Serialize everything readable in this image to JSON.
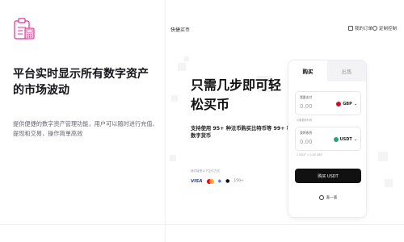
{
  "left": {
    "title": "平台实时显示所有数字资产的市场波动",
    "description": "提供便捷的数字资产管理功能，用户可以随时进行充值、提现和交易，操作简单高效",
    "logo_icon": "clipboard-calculator-icon"
  },
  "nav": {
    "brand": "快捷买币",
    "order_label": "我的订单",
    "bind_label": "定制控制"
  },
  "hero": {
    "title": "只需几步即可轻松买币",
    "subtitle": "支持使用 95+ 种法币购买比特币等 99+ 种数字货币",
    "payment_caption": "我们接受以下支付方式",
    "visa": "VISA",
    "more_methods": "150+"
  },
  "card": {
    "tabs": [
      {
        "label": "购买",
        "active": true
      },
      {
        "label": "出售",
        "active": false
      }
    ],
    "spend": {
      "label": "我要支付",
      "placeholder": "0.00",
      "currency": "GBP",
      "flag_color": "#c8102e",
      "note": "价格更新时间"
    },
    "receive": {
      "label": "我将收到",
      "placeholder": "0.00",
      "currency": "USDT",
      "coin_color": "#26a17b",
      "note": "1 USDT ≈ 0.XX GBP"
    },
    "buy_button": "购买 USDT",
    "more_link": "查一查"
  },
  "colors": {
    "logo_accent": "#e0339c",
    "button_bg": "#111111"
  }
}
